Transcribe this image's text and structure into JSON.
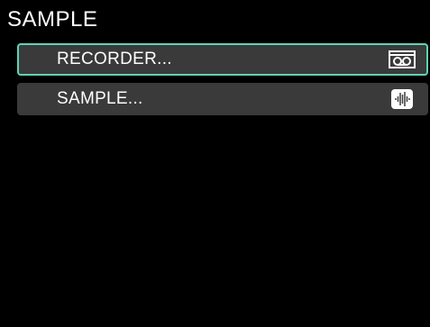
{
  "header": {
    "title": "SAMPLE"
  },
  "menu": {
    "items": [
      {
        "label": "RECORDER...",
        "icon": "cassette-tape-icon",
        "selected": true
      },
      {
        "label": "SAMPLE...",
        "icon": "waveform-icon",
        "selected": false
      }
    ]
  },
  "colors": {
    "background": "#000000",
    "item_background": "#3a3a3a",
    "selection_border": "#5fd3b3",
    "text": "#ffffff"
  }
}
